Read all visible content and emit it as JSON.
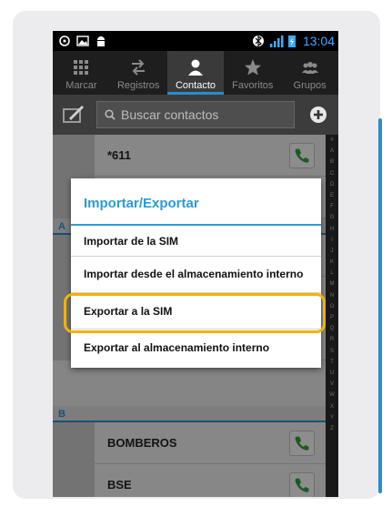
{
  "status_bar": {
    "time": "13:04",
    "left_icons": [
      "location-icon",
      "image-icon",
      "android-icon"
    ],
    "right_icons": [
      "bluetooth-icon",
      "signal-icon",
      "battery-icon"
    ]
  },
  "tabs": [
    {
      "label": "Marcar",
      "icon": "dialpad-icon",
      "active": false
    },
    {
      "label": "Registros",
      "icon": "call-log-icon",
      "active": false
    },
    {
      "label": "Contacto",
      "icon": "person-icon",
      "active": true
    },
    {
      "label": "Favoritos",
      "icon": "star-icon",
      "active": false
    },
    {
      "label": "Grupos",
      "icon": "group-icon",
      "active": false
    }
  ],
  "search": {
    "placeholder": "Buscar contactos"
  },
  "contacts": {
    "first": "*611",
    "section_a": "A",
    "section_b": "B",
    "bomberos": "BOMBEROS",
    "bse": "BSE"
  },
  "index_letters": [
    "#",
    "A",
    "B",
    "C",
    "D",
    "E",
    "F",
    "G",
    "H",
    "I",
    "J",
    "K",
    "L",
    "M",
    "N",
    "O",
    "P",
    "Q",
    "R",
    "S",
    "T",
    "U",
    "V",
    "W",
    "X",
    "Y",
    "Z"
  ],
  "dialog": {
    "title": "Importar/Exportar",
    "items": [
      "Importar de la SIM",
      "Importar desde el almacenamiento interno",
      "Exportar a la SIM",
      "Exportar al almacenamiento interno"
    ],
    "highlighted_item": "Exportar a la SIM"
  },
  "colors": {
    "accent": "#2a9bd7",
    "highlight": "#f2b200",
    "call_green": "#2e9e3a"
  }
}
